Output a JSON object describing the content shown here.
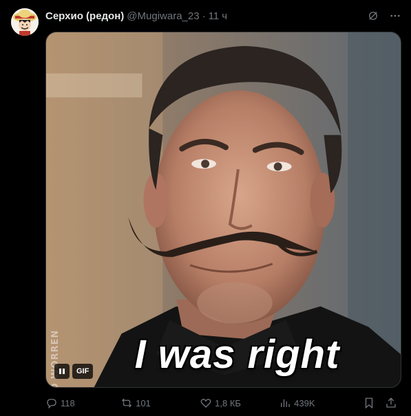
{
  "author": {
    "display_name": "Серхио (редон)",
    "handle": "@Mugiwara_23",
    "separator": "·",
    "time": "11 ч"
  },
  "media": {
    "caption": "I was right",
    "watermark": "DAVID WORREN",
    "gif_badge": "GIF"
  },
  "actions": {
    "replies": "118",
    "retweets": "101",
    "likes": "1,8 КБ",
    "views": "439K"
  },
  "colors": {
    "background": "#000000",
    "text": "#e7e9ea",
    "muted": "#71767b"
  }
}
